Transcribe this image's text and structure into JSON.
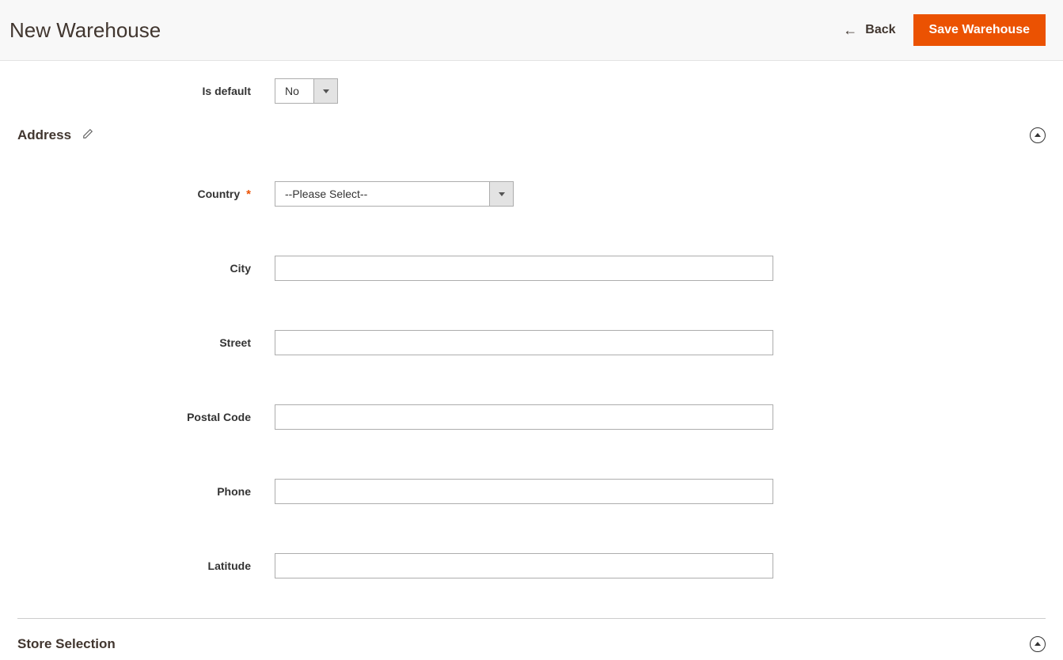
{
  "header": {
    "title": "New Warehouse",
    "back_label": "Back",
    "save_label": "Save Warehouse"
  },
  "fields": {
    "is_default": {
      "label": "Is default",
      "value": "No"
    },
    "country": {
      "label": "Country",
      "value": "--Please Select--"
    },
    "city": {
      "label": "City",
      "value": ""
    },
    "street": {
      "label": "Street",
      "value": ""
    },
    "postal_code": {
      "label": "Postal Code",
      "value": ""
    },
    "phone": {
      "label": "Phone",
      "value": ""
    },
    "latitude": {
      "label": "Latitude",
      "value": ""
    }
  },
  "sections": {
    "address": {
      "title": "Address"
    },
    "store_selection": {
      "title": "Store Selection"
    }
  }
}
